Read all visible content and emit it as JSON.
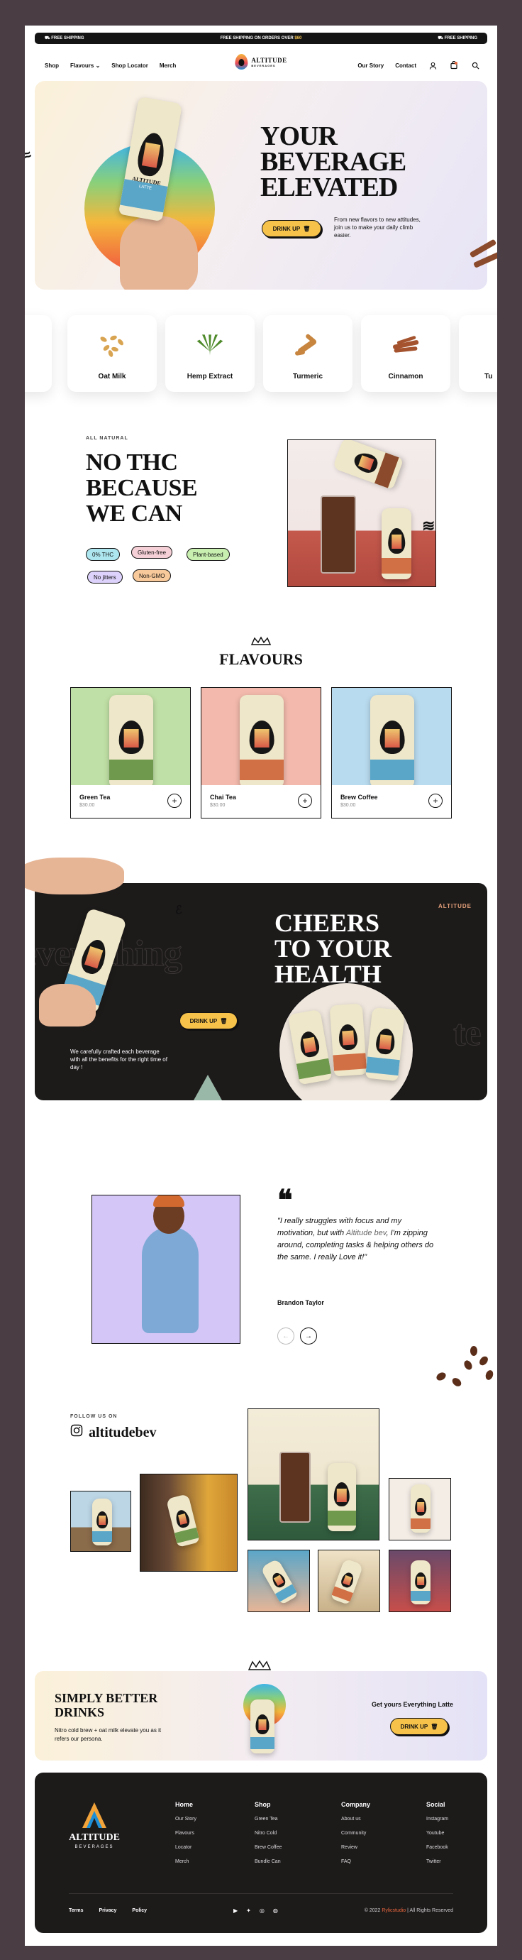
{
  "topbar": {
    "left": "FREE SHIPPING",
    "center_a": "FREE SHIPPING ON ORDERS OVER ",
    "center_b": "$60",
    "right": "FREE SHIPPING"
  },
  "nav": {
    "left": [
      "Shop",
      "Flavours",
      "Shop Locator",
      "Merch"
    ],
    "right": [
      "Our Story",
      "Contact"
    ],
    "logo": {
      "name": "ALTITUDE",
      "sub": "BEVERAGES"
    }
  },
  "hero": {
    "title_lines": [
      "YOUR",
      "BEVERAGE",
      "ELEVATED"
    ],
    "button": "DRINK UP",
    "description": "From new flavors to new attitudes, join us to make your daily climb easier.",
    "can_brand": "ALTITUDE",
    "can_flavor": "LATTE"
  },
  "ingredients": [
    "Oat Milk",
    "Hemp Extract",
    "Turmeric",
    "Cinnamon"
  ],
  "ingredients_partial": {
    "left": "ic",
    "right": "Tu"
  },
  "natural": {
    "label": "ALL NATURAL",
    "title_lines": [
      "NO THC",
      "BECAUSE",
      "WE CAN"
    ],
    "tags": [
      "0% THC",
      "Gluten-free",
      "Plant-based",
      "No jitters",
      "Non-GMO"
    ]
  },
  "flavours": {
    "title": "FLAVOURS",
    "items": [
      {
        "name": "Green Tea",
        "price": "$30.00",
        "bg": "#bfe0a6"
      },
      {
        "name": "Chai Tea",
        "price": "$30.00",
        "bg": "#f2b9ac"
      },
      {
        "name": "Brew Coffee",
        "price": "$30.00",
        "bg": "#b9dbef"
      }
    ]
  },
  "cheers": {
    "label": "ALTITUDE",
    "title_lines": [
      "CHEERS",
      "TO YOUR",
      "HEALTH"
    ],
    "bg_word": "everything",
    "button": "DRINK UP",
    "description": "We carefully crafted each beverage with all the benefits for the right time of day !"
  },
  "testimonial": {
    "quote_a": "\"I really struggles with focus and my motivation, but with ",
    "quote_brand": "Altitude bev",
    "quote_b": ", I'm zipping around, completing tasks & helping others do the same. I really Love it!\"",
    "author": "Brandon Taylor"
  },
  "social": {
    "label": "FOLLOW US ON",
    "handle": "altitudebev"
  },
  "cta": {
    "title_lines": [
      "SIMPLY BETTER",
      "DRINKS"
    ],
    "description": "Nitro cold brew + oat milk elevate you as it refers our persona.",
    "right_text": "Get yours Everything Latte",
    "button": "DRINK UP"
  },
  "footer": {
    "logo": {
      "name": "ALTITUDE",
      "sub": "BEVERAGES"
    },
    "columns": [
      {
        "title": "Home",
        "items": [
          "Our Story",
          "Flavours",
          "Locator",
          "Merch"
        ]
      },
      {
        "title": "Shop",
        "items": [
          "Green Tea",
          "Nitro Cold",
          "Brew Coffee",
          "Bundle Can"
        ]
      },
      {
        "title": "Company",
        "items": [
          "About us",
          "Community",
          "Review",
          "FAQ"
        ]
      },
      {
        "title": "Social",
        "items": [
          "Instagram",
          "Youtube",
          "Facebook",
          "Twitter"
        ]
      }
    ],
    "bottom_links": [
      "Terms",
      "Privacy",
      "Policy"
    ],
    "copyright_a": "© 2022 ",
    "copyright_brand": "Rylicstudio",
    "copyright_b": " | All Rights Reserved"
  },
  "colors": {
    "accent": "#f6c24a",
    "dark": "#1d1a1a",
    "brand_orange": "#e8673c"
  }
}
